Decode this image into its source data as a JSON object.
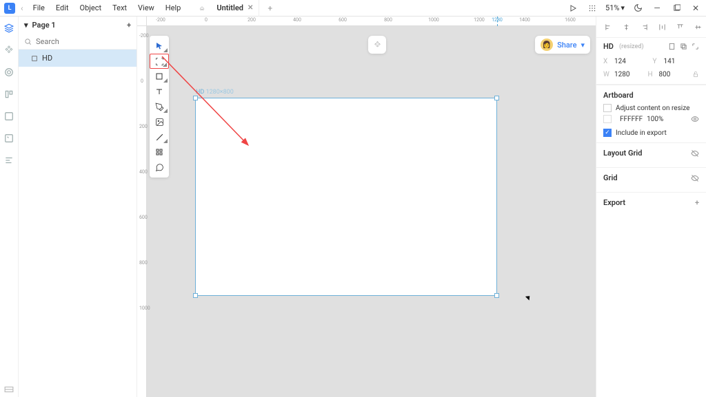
{
  "topbar": {
    "menus": [
      "File",
      "Edit",
      "Object",
      "Text",
      "View",
      "Help"
    ],
    "tab_title": "Untitled",
    "zoom": "51%"
  },
  "leftpanel": {
    "page_label": "Page 1",
    "search_placeholder": "Search",
    "layer_name": "HD"
  },
  "canvas": {
    "ruler_h": [
      "-200",
      "0",
      "200",
      "400",
      "600",
      "800",
      "1000",
      "1200",
      "1400",
      "1600"
    ],
    "ruler_h_mark": "1280",
    "ruler_v": [
      "-200",
      "0",
      "200",
      "400",
      "600",
      "800",
      "1000"
    ],
    "artboard_label": "HD",
    "artboard_dims": "1280×800",
    "share_label": "Share"
  },
  "inspector": {
    "name": "HD",
    "resized": "(resized)",
    "x_label": "X",
    "x": "124",
    "y_label": "Y",
    "y": "141",
    "w_label": "W",
    "w": "1280",
    "h_label": "H",
    "h": "800",
    "artboard_title": "Artboard",
    "adjust_label": "Adjust content on resize",
    "fill_hex": "FFFFFF",
    "fill_opacity": "100%",
    "include_label": "Include in export",
    "layout_grid": "Layout Grid",
    "grid": "Grid",
    "export": "Export"
  }
}
